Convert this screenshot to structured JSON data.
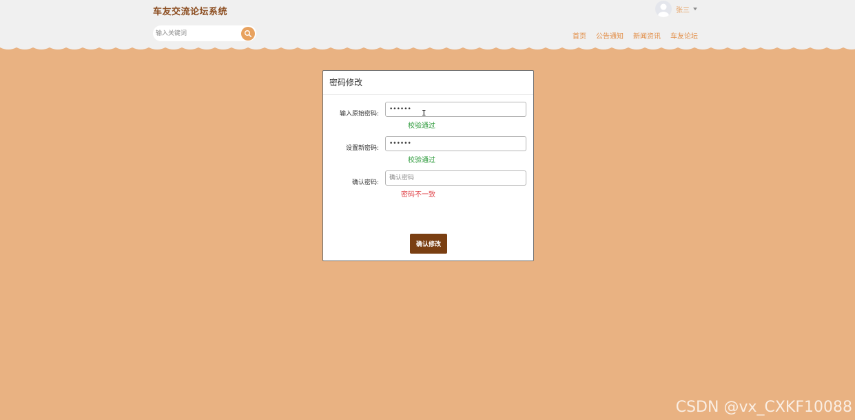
{
  "header": {
    "site_title": "车友交流论坛系统",
    "search": {
      "placeholder": "输入关键词"
    },
    "user": {
      "name": "张三"
    },
    "nav": [
      "首页",
      "公告通知",
      "新闻资讯",
      "车友论坛"
    ]
  },
  "card": {
    "title": "密码修改",
    "fields": [
      {
        "label": "输入原始密码:",
        "value": "••••••",
        "placeholder": "",
        "message": "校验通过",
        "status": "ok"
      },
      {
        "label": "设置新密码:",
        "value": "••••••",
        "placeholder": "",
        "message": "校验通过",
        "status": "ok"
      },
      {
        "label": "确认密码:",
        "value": "",
        "placeholder": "确认密码",
        "message": "密码不一致",
        "status": "error"
      }
    ],
    "submit_label": "确认修改"
  },
  "watermark": "CSDN @vx_CXKF10088",
  "colors": {
    "page_bg": "#e9b282",
    "header_bg": "#f0f0f0",
    "title": "#8a4a1c",
    "accent": "#e28e47",
    "button": "#7a3f12",
    "ok": "#2e9b3c",
    "error": "#e0474c"
  }
}
